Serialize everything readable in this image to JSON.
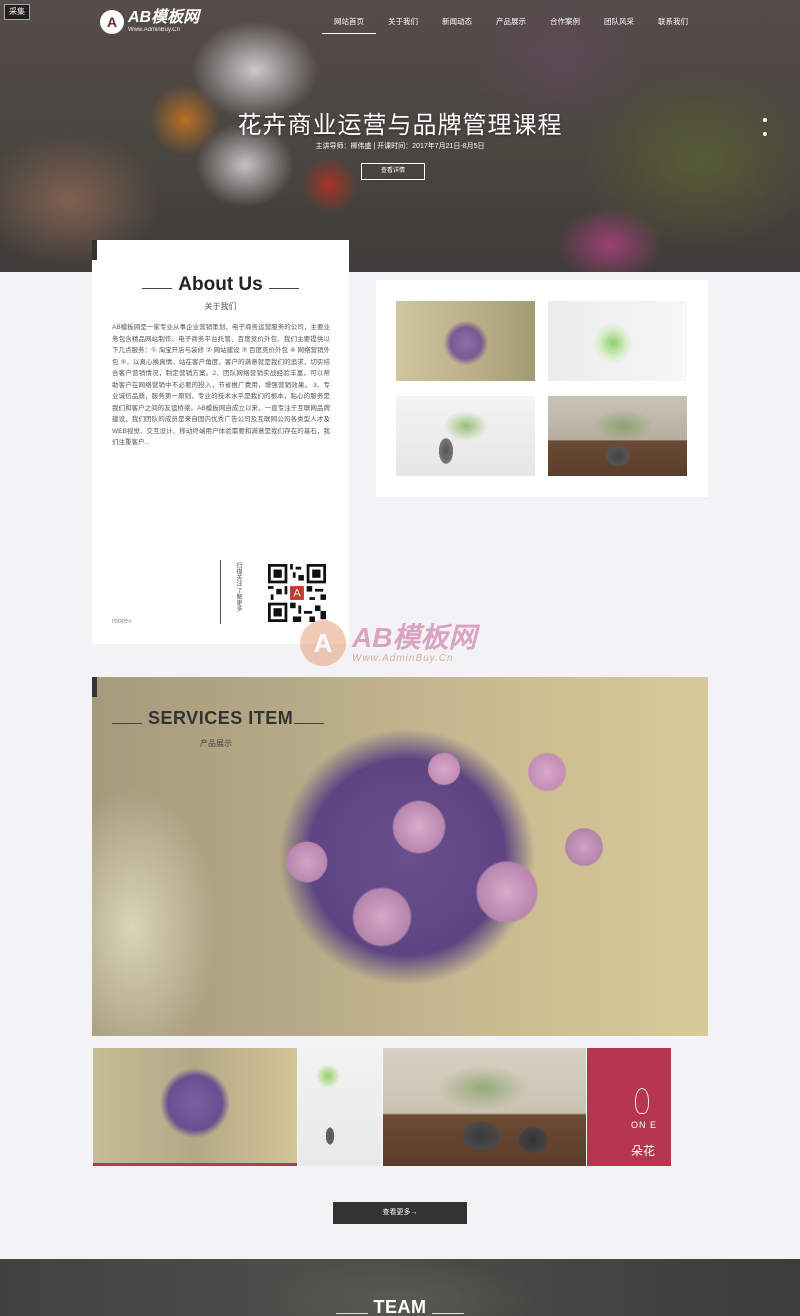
{
  "header": {
    "tag_button": "采集",
    "logo": {
      "mark": "A",
      "name": "AB模板网",
      "url_text": "Www.AdminBuy.Cn"
    },
    "nav": [
      {
        "label": "网站首页",
        "active": true
      },
      {
        "label": "关于我们",
        "active": false
      },
      {
        "label": "新闻动态",
        "active": false
      },
      {
        "label": "产品展示",
        "active": false
      },
      {
        "label": "合作案例",
        "active": false
      },
      {
        "label": "团队风采",
        "active": false
      },
      {
        "label": "联系我们",
        "active": false
      }
    ]
  },
  "hero": {
    "title": "花卉商业运营与品牌管理课程",
    "subtitle": "主讲导师：柳伟盛 | 开课时间：2017年7月21日-8月5日",
    "button": "查看详情"
  },
  "about": {
    "title": "About Us",
    "subtitle": "关于我们",
    "text": "AB模板网是一家专业从事企业营销策划、电子商务运营服务的公司，主要业务包含精品网站制作、电子商务平台托管、百度竞价外包、我们主要提供以下几点服务：① 淘宝开店与装修 ② 网站建设 ③ 百度竞价外包 ④ 网络营销外包 ⑤，以真心换真情，站在客户角度，客户的满意就是我们的追求，切实结合客户营销情况，制定营销方案。2、团队网络营销实战经验丰富，可以帮助客户在网络营销中不必要的投入，节省推广费用，增强营销效果。 3、专业诚信品质，服务第一原则，专业的技术水平是我们的根本，贴心的服务是我们和客户之间的友谊桥梁。AB模板网自成立以来，一直专注于互联网品牌建设，我们团队的成员是来自国内优秀广告公司及互联网公司各类型人才及WEB视觉、交互设计、移动终端用户体验需要和满意是我们存在的基石，我们注重客户...",
    "vertical_text": "扫描关注 了解更多",
    "more": "more»"
  },
  "watermark": {
    "mark": "A",
    "name": "AB模板网",
    "url_text": "Www.AdminBuy.Cn"
  },
  "services": {
    "title": "SERVICES ITEM",
    "subtitle": "产品展示",
    "brand_card": {
      "one": "ON E",
      "cn": "朵花"
    },
    "view_more": "查看更多→"
  },
  "team": {
    "title": "TEAM"
  }
}
